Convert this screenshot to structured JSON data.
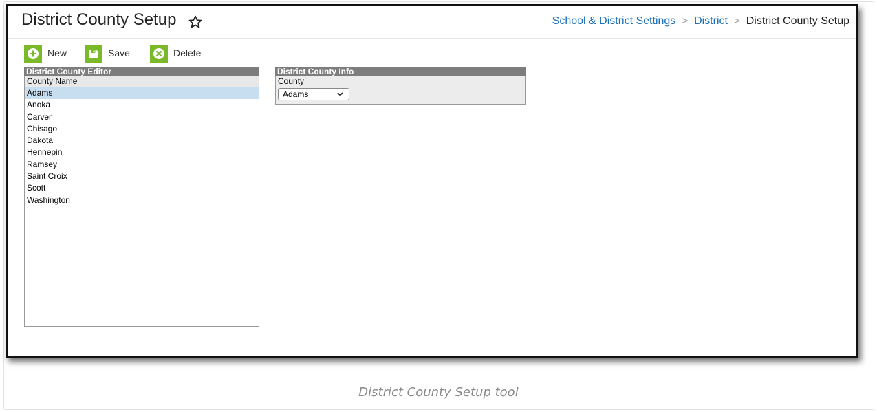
{
  "header": {
    "title": "District County Setup",
    "breadcrumb": [
      "School & District Settings",
      "District",
      "District County Setup"
    ]
  },
  "toolbar": {
    "new_label": "New",
    "save_label": "Save",
    "delete_label": "Delete",
    "icon_color": "#7ab929"
  },
  "editor": {
    "title": "District County Editor",
    "column_header": "County Name",
    "selected": "Adams",
    "rows": [
      "Adams",
      "Anoka",
      "Carver",
      "Chisago",
      "Dakota",
      "Hennepin",
      "Ramsey",
      "Saint Croix",
      "Scott",
      "Washington"
    ]
  },
  "info": {
    "title": "District County Info",
    "county_label": "County",
    "county_value": "Adams"
  },
  "caption": "District County Setup tool",
  "colors": {
    "link": "#1a6fb5",
    "panel_header": "#7d7d7d",
    "selected_row": "#c7def0"
  }
}
